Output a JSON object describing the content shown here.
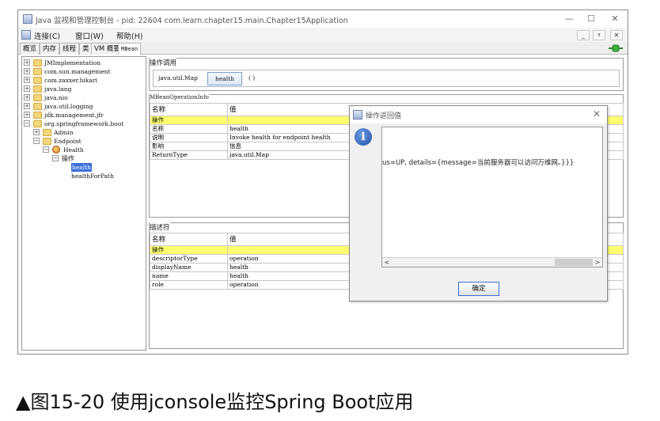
{
  "window": {
    "title": "Java 监视和管理控制台 - pid: 22604 com.learn.chapter15.main.Chapter15Application",
    "controls": {
      "minimize": "—",
      "maximize": "☐",
      "close": "✕"
    }
  },
  "menubar": {
    "items": [
      "连接(C)",
      "窗口(W)",
      "帮助(H)"
    ],
    "mdi": {
      "minimize": "_",
      "restore": "ᵍ",
      "close": "✕"
    }
  },
  "tabs": [
    "概览",
    "内存",
    "线程",
    "类",
    "VM 概要",
    "MBean"
  ],
  "active_tab": "MBean",
  "tree": {
    "nodes": [
      {
        "label": "JMImplementation",
        "toggle": "+"
      },
      {
        "label": "com.sun.management",
        "toggle": "+"
      },
      {
        "label": "com.zaxxer.hikari",
        "toggle": "+"
      },
      {
        "label": "java.lang",
        "toggle": "+"
      },
      {
        "label": "java.nio",
        "toggle": "+"
      },
      {
        "label": "java.util.logging",
        "toggle": "+"
      },
      {
        "label": "jdk.management.jfr",
        "toggle": "+"
      },
      {
        "label": "org.springframework.boot",
        "toggle": "−"
      },
      {
        "label": "Admin",
        "toggle": "+"
      },
      {
        "label": "Endpoint",
        "toggle": "−"
      },
      {
        "label": "Health",
        "toggle": "−"
      },
      {
        "label": "操作",
        "toggle": "−"
      },
      {
        "label": "health",
        "toggle": ""
      },
      {
        "label": "healthForPath",
        "toggle": ""
      }
    ]
  },
  "operation_panel": {
    "title": "操作调用",
    "return_type": "java.util.Map",
    "button": "health",
    "params": "( )"
  },
  "info_panel": {
    "title": "MBeanOperationInfo",
    "headers": [
      "名称",
      "值"
    ],
    "rows": [
      [
        "操作",
        ""
      ],
      [
        "名称",
        "health"
      ],
      [
        "说明",
        "Invoke health for endpoint health"
      ],
      [
        "影响",
        "信息"
      ],
      [
        "ReturnType",
        "java.util.Map"
      ]
    ]
  },
  "descriptor_panel": {
    "title": "描述符",
    "headers": [
      "名称",
      "值"
    ],
    "rows": [
      [
        "操作",
        ""
      ],
      [
        "descriptorType",
        "operation"
      ],
      [
        "displayName",
        "health"
      ],
      [
        "name",
        "health"
      ],
      [
        "role",
        "operation"
      ]
    ]
  },
  "dialog": {
    "title": "操作返回值",
    "info_glyph": "i",
    "result": "us=UP, details={message=当前服务器可以访问万维网。}}}",
    "scroll_left": "<",
    "scroll_right": ">",
    "ok_label": "确定",
    "close": "✕"
  },
  "caption": "▲图15-20 使用jconsole监控Spring Boot应用",
  "colors": {
    "selection": "#3a6fd8",
    "highlight_row": "#ffff70"
  }
}
